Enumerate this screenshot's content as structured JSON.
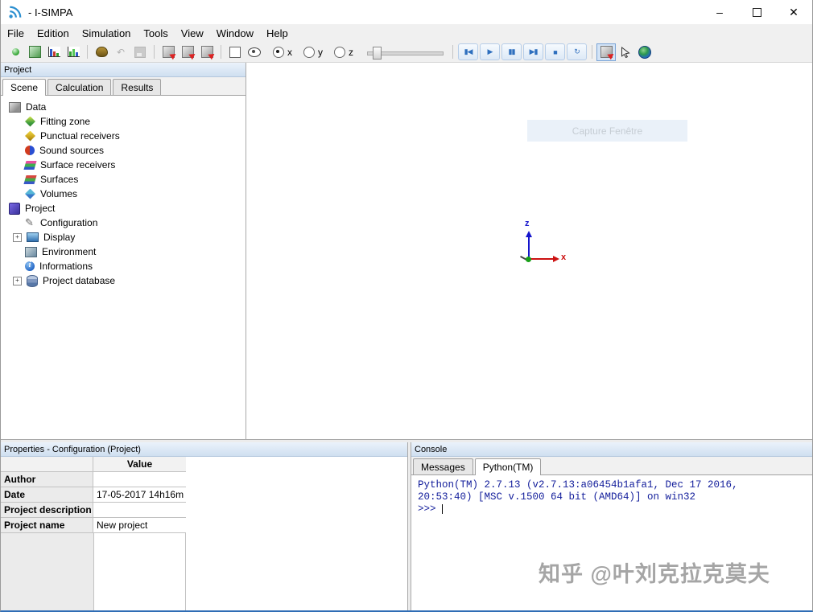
{
  "window": {
    "title": "- I-SIMPA",
    "minimize_glyph": "–",
    "close_glyph": "✕"
  },
  "menu_bar": {
    "items": [
      {
        "label": "File"
      },
      {
        "label": "Edition"
      },
      {
        "label": "Simulation"
      },
      {
        "label": "Tools"
      },
      {
        "label": "View"
      },
      {
        "label": "Window"
      },
      {
        "label": "Help"
      }
    ]
  },
  "toolbar": {
    "icons": {
      "undo": "↶",
      "skip_start": "▮◀",
      "play": "▶",
      "pause": "▮▮",
      "skip_end": "▶▮",
      "stop": "■",
      "refresh": "↻"
    },
    "axis_radios": [
      {
        "label": "x",
        "selected": true
      },
      {
        "label": "y",
        "selected": false
      },
      {
        "label": "z",
        "selected": false
      }
    ]
  },
  "project_panel": {
    "title": "Project",
    "tabs": [
      {
        "label": "Scene",
        "active": true
      },
      {
        "label": "Calculation",
        "active": false
      },
      {
        "label": "Results",
        "active": false
      }
    ],
    "tree": [
      {
        "label": "Data",
        "depth": 0,
        "icon": "data"
      },
      {
        "label": "Fitting zone",
        "depth": 1,
        "icon": "fitting-zone"
      },
      {
        "label": "Punctual receivers",
        "depth": 1,
        "icon": "punctual-receivers"
      },
      {
        "label": "Sound sources",
        "depth": 1,
        "icon": "sound-sources"
      },
      {
        "label": "Surface receivers",
        "depth": 1,
        "icon": "surface-receivers"
      },
      {
        "label": "Surfaces",
        "depth": 1,
        "icon": "surfaces"
      },
      {
        "label": "Volumes",
        "depth": 1,
        "icon": "volumes"
      },
      {
        "label": "Project",
        "depth": 0,
        "icon": "project"
      },
      {
        "label": "Configuration",
        "depth": 1,
        "icon": "configuration"
      },
      {
        "label": "Display",
        "depth": 1,
        "icon": "display",
        "expander": "+"
      },
      {
        "label": "Environment",
        "depth": 1,
        "icon": "environment"
      },
      {
        "label": "Informations",
        "depth": 1,
        "icon": "informations"
      },
      {
        "label": "Project database",
        "depth": 1,
        "icon": "project-database",
        "expander": "+"
      }
    ]
  },
  "viewport": {
    "capture_label": "Capture Fenêtre",
    "axis_x_label": "x",
    "axis_z_label": "z"
  },
  "properties_panel": {
    "title": "Properties - Configuration (Project)",
    "value_column_header": "Value",
    "rows": [
      {
        "label": "Author",
        "value": ""
      },
      {
        "label": "Date",
        "value": "17-05-2017 14h16m"
      },
      {
        "label": "Project description",
        "value": ""
      },
      {
        "label": "Project name",
        "value": "New project"
      }
    ]
  },
  "console_panel": {
    "title": "Console",
    "tabs": [
      {
        "label": "Messages",
        "active": false
      },
      {
        "label": "Python(TM)",
        "active": true
      }
    ],
    "lines": [
      "Python(TM) 2.7.13 (v2.7.13:a06454b1afa1, Dec 17 2016,",
      "20:53:40) [MSC v.1500 64 bit (AMD64)] on win32",
      ">>>"
    ]
  },
  "watermark": {
    "text": "知乎 @叶刘克拉克莫夫"
  },
  "colors": {
    "panel_header": "#cfdff0",
    "console_text": "#121d9b",
    "axis_x": "#cc1111",
    "axis_z": "#1414cc",
    "origin_green": "#18a018",
    "accent_blue": "#2e6fbe"
  }
}
